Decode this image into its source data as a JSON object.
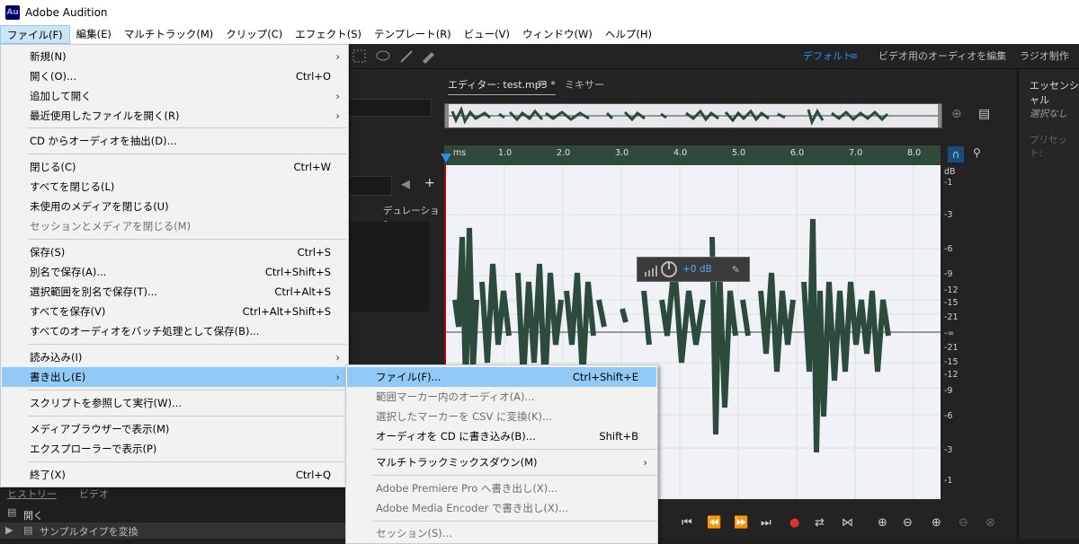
{
  "app": {
    "title": "Adobe Audition",
    "icon_text": "Au"
  },
  "menubar": [
    "ファイル(F)",
    "編集(E)",
    "マルチトラック(M)",
    "クリップ(C)",
    "エフェクト(S)",
    "テンプレート(R)",
    "ビュー(V)",
    "ウィンドウ(W)",
    "ヘルプ(H)"
  ],
  "workspaces": {
    "default": "デフォルト",
    "video": "ビデオ用のオーディオを編集",
    "radio": "ラジオ制作"
  },
  "editor": {
    "tab_editor": "エディター: test.mp3 *",
    "tab_mixer": "ミキサー",
    "ruler_ticks": [
      "ms",
      "1.0",
      "2.0",
      "3.0",
      "4.0",
      "5.0",
      "6.0",
      "7.0",
      "8.0"
    ],
    "db_labels": [
      "dB",
      "-1",
      "-3",
      "-6",
      "-9",
      "-12",
      "-15",
      "-21",
      "-∞",
      "-21",
      "-15",
      "-12",
      "-9",
      "-6",
      "-3",
      "-1"
    ],
    "hud_value": "+0 dB"
  },
  "files_panel": {
    "column": "デュレーション"
  },
  "right_panel": {
    "title": "エッセンシャル",
    "selection": "選択なし",
    "preset": "プリセット:"
  },
  "bottom_panel": {
    "tab_history": "ヒストリー",
    "tab_video": "ビデオ",
    "row1": "開く",
    "row2": "サンプルタイプを変換"
  },
  "file_menu": [
    {
      "label": "新規(N)",
      "shortcut": "",
      "submenu": true,
      "disabled": false
    },
    {
      "label": "開く(O)...",
      "shortcut": "Ctrl+O",
      "submenu": false,
      "disabled": false
    },
    {
      "label": "追加して開く",
      "shortcut": "",
      "submenu": true,
      "disabled": false
    },
    {
      "label": "最近使用したファイルを開く(R)",
      "shortcut": "",
      "submenu": true,
      "disabled": false
    },
    {
      "label": "CD からオーディオを抽出(D)...",
      "shortcut": "",
      "submenu": false,
      "disabled": false
    },
    {
      "label": "閉じる(C)",
      "shortcut": "Ctrl+W",
      "submenu": false,
      "disabled": false
    },
    {
      "label": "すべてを閉じる(L)",
      "shortcut": "",
      "submenu": false,
      "disabled": false
    },
    {
      "label": "未使用のメディアを閉じる(U)",
      "shortcut": "",
      "submenu": false,
      "disabled": false
    },
    {
      "label": "セッションとメディアを閉じる(M)",
      "shortcut": "",
      "submenu": false,
      "disabled": true
    },
    {
      "label": "保存(S)",
      "shortcut": "Ctrl+S",
      "submenu": false,
      "disabled": false
    },
    {
      "label": "別名で保存(A)...",
      "shortcut": "Ctrl+Shift+S",
      "submenu": false,
      "disabled": false
    },
    {
      "label": "選択範囲を別名で保存(T)...",
      "shortcut": "Ctrl+Alt+S",
      "submenu": false,
      "disabled": false
    },
    {
      "label": "すべてを保存(V)",
      "shortcut": "Ctrl+Alt+Shift+S",
      "submenu": false,
      "disabled": false
    },
    {
      "label": "すべてのオーディオをバッチ処理として保存(B)...",
      "shortcut": "",
      "submenu": false,
      "disabled": false
    },
    {
      "label": "読み込み(I)",
      "shortcut": "",
      "submenu": true,
      "disabled": false
    },
    {
      "label": "書き出し(E)",
      "shortcut": "",
      "submenu": true,
      "disabled": false
    },
    {
      "label": "スクリプトを参照して実行(W)...",
      "shortcut": "",
      "submenu": false,
      "disabled": false
    },
    {
      "label": "メディアブラウザーで表示(M)",
      "shortcut": "",
      "submenu": false,
      "disabled": false
    },
    {
      "label": "エクスプローラーで表示(P)",
      "shortcut": "",
      "submenu": false,
      "disabled": false
    },
    {
      "label": "終了(X)",
      "shortcut": "Ctrl+Q",
      "submenu": false,
      "disabled": false
    }
  ],
  "export_submenu": [
    {
      "label": "ファイル(F)...",
      "shortcut": "Ctrl+Shift+E",
      "submenu": false,
      "disabled": false
    },
    {
      "label": "範囲マーカー内のオーディオ(A)...",
      "shortcut": "",
      "submenu": false,
      "disabled": true
    },
    {
      "label": "選択したマーカーを CSV に変換(K)...",
      "shortcut": "",
      "submenu": false,
      "disabled": true
    },
    {
      "label": "オーディオを CD に書き込み(B)...",
      "shortcut": "Shift+B",
      "submenu": false,
      "disabled": false
    },
    {
      "label": "マルチトラックミックスダウン(M)",
      "shortcut": "",
      "submenu": true,
      "disabled": false
    },
    {
      "label": "Adobe Premiere Pro へ書き出し(X)...",
      "shortcut": "",
      "submenu": false,
      "disabled": true
    },
    {
      "label": "Adobe Media Encoder で書き出し(X)...",
      "shortcut": "",
      "submenu": false,
      "disabled": true
    },
    {
      "label": "セッション(S)...",
      "shortcut": "",
      "submenu": false,
      "disabled": true
    }
  ],
  "colors": {
    "accent": "#2d8ceb",
    "waveform": "#2d4b3c",
    "highlight": "#91c9f7"
  }
}
